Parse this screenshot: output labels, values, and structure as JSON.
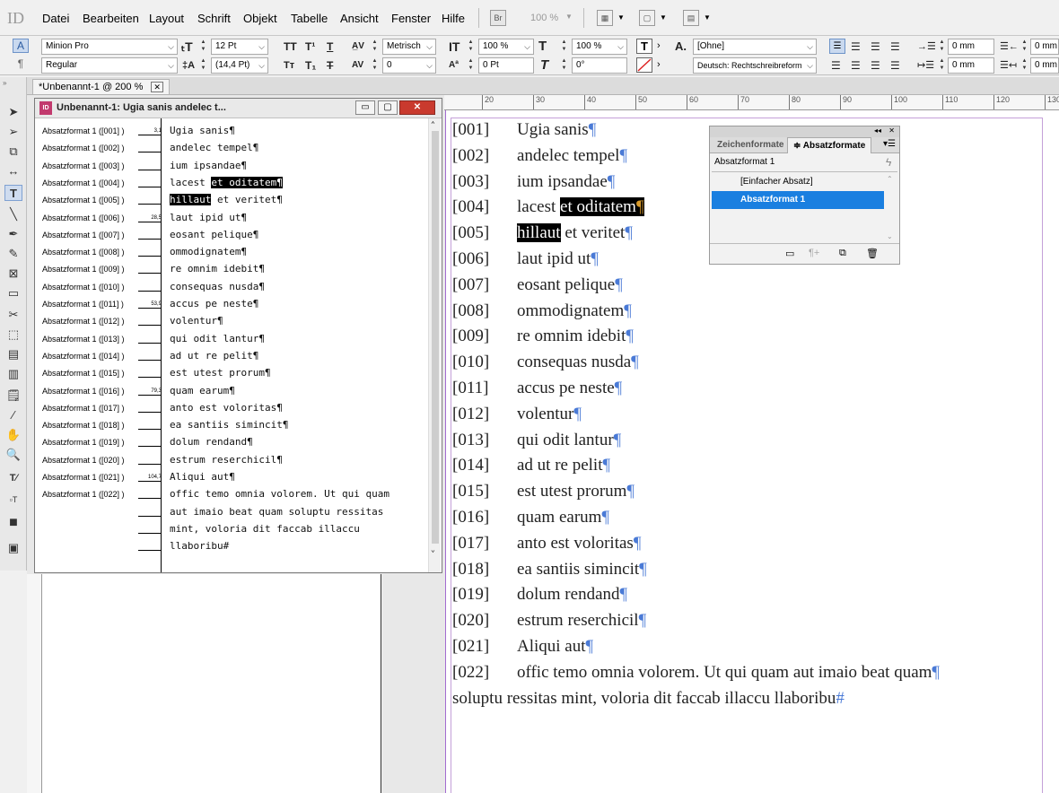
{
  "app_logo": "ID",
  "menubar": {
    "items": [
      "Datei",
      "Bearbeiten",
      "Layout",
      "Schrift",
      "Objekt",
      "Tabelle",
      "Ansicht",
      "Fenster",
      "Hilfe"
    ],
    "bridge_label": "Br",
    "zoom": "100 %"
  },
  "control": {
    "font_family": "Minion Pro",
    "font_style": "Regular",
    "font_size": "12 Pt",
    "leading": "(14,4 Pt)",
    "kerning": "Metrisch",
    "tracking": "0",
    "vertical_scale": "100 %",
    "horizontal_scale": "100 %",
    "baseline_shift": "0 Pt",
    "skew": "0°",
    "char_style": "[Ohne]",
    "language": "Deutsch: Rechtschreibreform",
    "indent_left": "0 mm",
    "indent_right": "0 mm",
    "indent_first": "0 mm",
    "indent_last": "0 mm"
  },
  "tab": {
    "title": "*Unbenannt-1 @ 200 %"
  },
  "ruler": {
    "labels": [
      "20",
      "30",
      "40",
      "50",
      "60",
      "70",
      "80",
      "90",
      "100",
      "110",
      "120",
      "130"
    ]
  },
  "story_editor": {
    "title": "Unbenannt-1: Ugia sanis andelec t...",
    "rows": [
      {
        "style": "Absatzformat 1 ([001] )",
        "depth": "3,1",
        "text": "Ugia sanis¶"
      },
      {
        "style": "Absatzformat 1 ([002] )",
        "depth": "",
        "text": "andelec tempel¶"
      },
      {
        "style": "Absatzformat 1 ([003] )",
        "depth": "",
        "text": "ium ipsandae¶"
      },
      {
        "style": "Absatzformat 1 ([004] )",
        "depth": "",
        "text": "lacest ",
        "sel": "et oditatem¶"
      },
      {
        "style": "Absatzformat 1 ([005] )",
        "depth": "",
        "seltext": "hillaut",
        "text": " et veritet¶"
      },
      {
        "style": "Absatzformat 1 ([006] )",
        "depth": "28,5",
        "text": "laut ipid ut¶"
      },
      {
        "style": "Absatzformat 1 ([007] )",
        "depth": "",
        "text": "eosant pelique¶"
      },
      {
        "style": "Absatzformat 1 ([008] )",
        "depth": "",
        "text": "ommodignatem¶"
      },
      {
        "style": "Absatzformat 1 ([009] )",
        "depth": "",
        "text": "re omnim idebit¶"
      },
      {
        "style": "Absatzformat 1 ([010] )",
        "depth": "",
        "text": "consequas nusda¶"
      },
      {
        "style": "Absatzformat 1 ([011] )",
        "depth": "53,9",
        "text": "accus pe neste¶"
      },
      {
        "style": "Absatzformat 1 ([012] )",
        "depth": "",
        "text": "volentur¶"
      },
      {
        "style": "Absatzformat 1 ([013] )",
        "depth": "",
        "text": "qui odit lantur¶"
      },
      {
        "style": "Absatzformat 1 ([014] )",
        "depth": "",
        "text": "ad ut re pelit¶"
      },
      {
        "style": "Absatzformat 1 ([015] )",
        "depth": "",
        "text": "est utest prorum¶"
      },
      {
        "style": "Absatzformat 1 ([016] )",
        "depth": "79,3",
        "text": "quam earum¶"
      },
      {
        "style": "Absatzformat 1 ([017] )",
        "depth": "",
        "text": "anto est voloritas¶"
      },
      {
        "style": "Absatzformat 1 ([018] )",
        "depth": "",
        "text": "ea santiis simincit¶"
      },
      {
        "style": "Absatzformat 1 ([019] )",
        "depth": "",
        "text": "dolum rendand¶"
      },
      {
        "style": "Absatzformat 1 ([020] )",
        "depth": "",
        "text": "estrum reserchicil¶"
      },
      {
        "style": "Absatzformat 1 ([021] )",
        "depth": "104,7",
        "text": "Aliqui aut¶"
      },
      {
        "style": "Absatzformat 1 ([022] )",
        "depth": "",
        "text": "offic temo omnia volorem. Ut qui quam"
      },
      {
        "style": "",
        "depth": "",
        "text": "aut imaio beat quam soluptu ressitas"
      },
      {
        "style": "",
        "depth": "",
        "text": "mint, voloria dit faccab illaccu"
      },
      {
        "style": "",
        "depth": "",
        "text": "llaboribu#"
      }
    ]
  },
  "layout_text": [
    {
      "num": "[001]",
      "text": "Ugia sanis"
    },
    {
      "num": "[002]",
      "text": "andelec tempel"
    },
    {
      "num": "[003]",
      "text": "ium ipsandae"
    },
    {
      "num": "[004]",
      "text": "lacest ",
      "sel": "et oditatem"
    },
    {
      "num": "[005]",
      "seltext": "hillaut",
      "text": " et veritet"
    },
    {
      "num": "[006]",
      "text": "laut ipid ut"
    },
    {
      "num": "[007]",
      "text": "eosant pelique"
    },
    {
      "num": "[008]",
      "text": "ommodignatem"
    },
    {
      "num": "[009]",
      "text": "re omnim idebit"
    },
    {
      "num": "[010]",
      "text": "consequas nusda"
    },
    {
      "num": "[011]",
      "text": "accus pe neste"
    },
    {
      "num": "[012]",
      "text": "volentur"
    },
    {
      "num": "[013]",
      "text": "qui odit lantur"
    },
    {
      "num": "[014]",
      "text": "ad ut re pelit"
    },
    {
      "num": "[015]",
      "text": "est utest prorum"
    },
    {
      "num": "[016]",
      "text": "quam earum"
    },
    {
      "num": "[017]",
      "text": "anto est voloritas"
    },
    {
      "num": "[018]",
      "text": "ea santiis simincit"
    },
    {
      "num": "[019]",
      "text": "dolum rendand"
    },
    {
      "num": "[020]",
      "text": "estrum reserchicil"
    },
    {
      "num": "[021]",
      "text": "Aliqui aut"
    },
    {
      "num": "[022]",
      "text": "offic temo omnia volorem. Ut qui quam aut imaio beat quam"
    },
    {
      "num": "",
      "text": "soluptu ressitas mint, voloria dit faccab illaccu llaboribu",
      "end": "#"
    }
  ],
  "styles_panel": {
    "tab_char": "Zeichenformate",
    "tab_para": "Absatzformate",
    "current": "Absatzformat 1",
    "items": [
      "[Einfacher Absatz]",
      "Absatzformat 1"
    ],
    "selected_color": "#1a7fe0"
  }
}
